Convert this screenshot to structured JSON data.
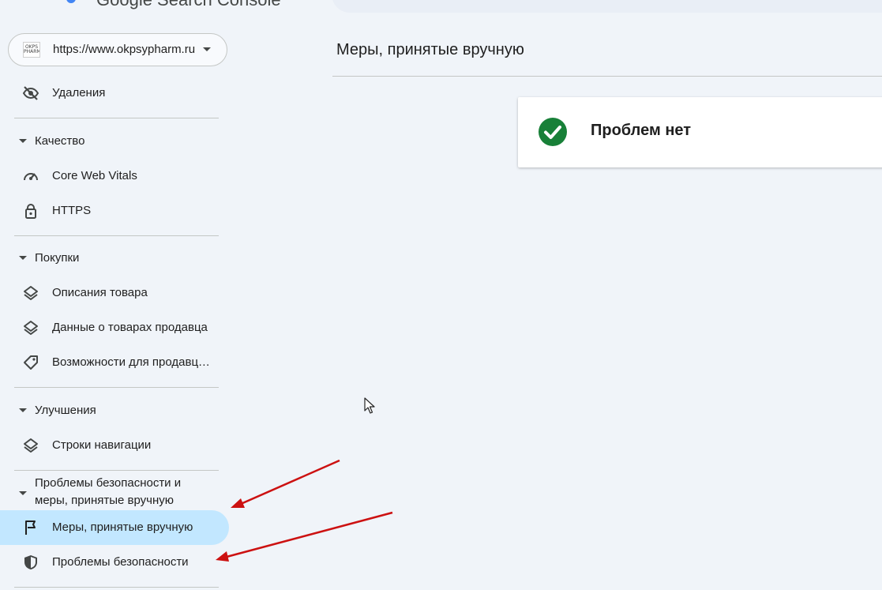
{
  "header": {
    "app_title": "Google Search Console",
    "search_fragment": "",
    "logo_colors": [
      "#4285f4",
      "#ea4335",
      "#fbbc04",
      "#34a853"
    ]
  },
  "property": {
    "url": "https://www.okpsypharm.ru",
    "favicon_text": "OKPS PHARM",
    "dropdown_icon": "caret-down-icon"
  },
  "sidebar": {
    "removals": {
      "label": "Удаления",
      "icon": "eye-off-icon"
    },
    "sections": [
      {
        "title": "Качество",
        "items": [
          {
            "label": "Core Web Vitals",
            "icon": "speedometer-icon"
          },
          {
            "label": "HTTPS",
            "icon": "lock-icon"
          }
        ]
      },
      {
        "title": "Покупки",
        "items": [
          {
            "label": "Описания товара",
            "icon": "layers-icon"
          },
          {
            "label": "Данные о товарах продавца",
            "icon": "layers-icon"
          },
          {
            "label": "Возможности для продавцов",
            "icon": "tag-icon"
          }
        ]
      },
      {
        "title": "Улучшения",
        "items": [
          {
            "label": "Строки навигации",
            "icon": "layers-icon"
          }
        ]
      },
      {
        "title": "Проблемы безопасности и меры, принятые вручную",
        "items": [
          {
            "label": "Меры, принятые вручную",
            "icon": "flag-icon",
            "active": true
          },
          {
            "label": "Проблемы безопасности",
            "icon": "shield-icon"
          }
        ]
      }
    ]
  },
  "main": {
    "page_title": "Меры, принятые вручную",
    "status": {
      "text": "Проблем нет",
      "icon": "check-circle-icon",
      "color": "#188038"
    }
  },
  "colors": {
    "background": "#f0f4f9",
    "active_item": "#c2e7ff",
    "annotation_arrow": "#cc1111"
  }
}
